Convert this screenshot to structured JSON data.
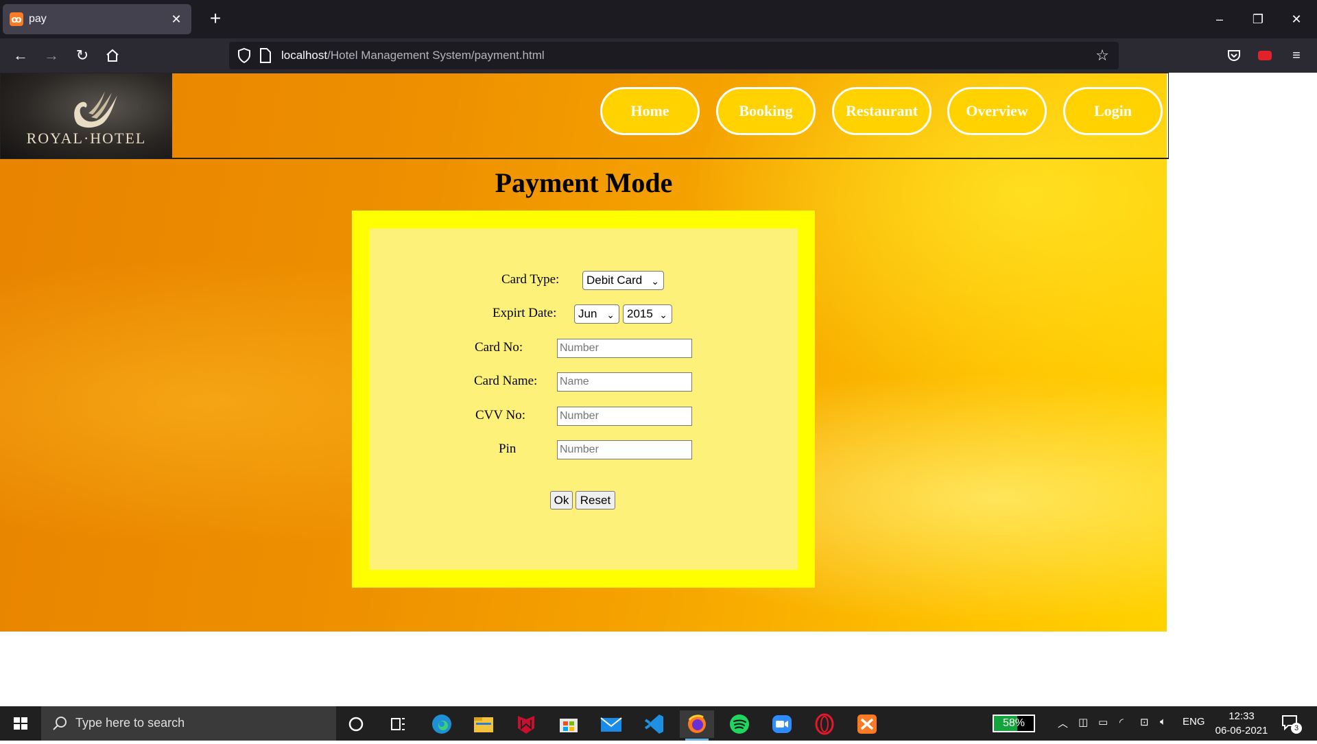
{
  "browser": {
    "tab_title": "pay",
    "url_host": "localhost",
    "url_path": "/Hotel Management System/payment.html"
  },
  "site": {
    "logo_text": "ROYAL·HOTEL",
    "nav": [
      {
        "label": "Home"
      },
      {
        "label": "Booking"
      },
      {
        "label": "Restaurant"
      },
      {
        "label": "Overview"
      },
      {
        "label": "Login"
      }
    ],
    "page_title": "Payment Mode"
  },
  "form": {
    "card_type_label": "Card Type:",
    "card_type_value": "Debit Card",
    "expiry_label": "Expirt Date:",
    "expiry_month": "Jun",
    "expiry_year": "2015",
    "card_no_label": "Card No:",
    "card_no_placeholder": "Number",
    "card_name_label": "Card Name:",
    "card_name_placeholder": "Name",
    "cvv_label": "CVV No:",
    "cvv_placeholder": "Number",
    "pin_label": "Pin",
    "pin_placeholder": "Number",
    "ok_label": "Ok",
    "reset_label": "Reset"
  },
  "taskbar": {
    "search_placeholder": "Type here to search",
    "battery_percent": "58%",
    "battery_level": 0.58,
    "language": "ENG",
    "time": "12:33",
    "date": "06-06-2021",
    "notification_count": "3"
  },
  "colors": {
    "nav_pill": "#ffd200",
    "form_border": "#ffff00",
    "form_fill": "#fdf17a"
  }
}
